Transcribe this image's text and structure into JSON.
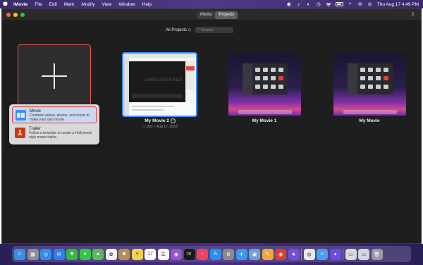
{
  "menubar": {
    "app_name": "iMovie",
    "items": [
      "File",
      "Edit",
      "Mark",
      "Modify",
      "View",
      "Window",
      "Help"
    ],
    "clock": "Thu Aug 17  4:49 PM"
  },
  "toolbar": {
    "tabs": [
      {
        "label": "Media",
        "active": false
      },
      {
        "label": "Projects",
        "active": true
      }
    ]
  },
  "filter": {
    "label": "All Projects ◇",
    "search_placeholder": "Search"
  },
  "projects": [
    {
      "name": "My Movie 2",
      "meta": "20s – Aug 17, 2023",
      "selected": true,
      "thumb_text": "UNREGISTERED"
    },
    {
      "name": "My Movie 1",
      "meta": "",
      "selected": false
    },
    {
      "name": "My Movie",
      "meta": "",
      "selected": false
    }
  ],
  "new_menu": {
    "items": [
      {
        "title": "Movie",
        "description": "Combine videos, photos, and music to make your own movie.",
        "highlighted": true
      },
      {
        "title": "Trailer",
        "description": "Follow a template to create a Hollywood style movie trailer.",
        "highlighted": false
      }
    ]
  },
  "dock": {
    "apps": [
      {
        "icon": "finder-icon",
        "glyph": "☺",
        "color": "#3a8ee6"
      },
      {
        "icon": "launchpad-icon",
        "glyph": "▦",
        "color": "#8d8d9a"
      },
      {
        "icon": "safari-icon",
        "glyph": "◎",
        "color": "#2f8df0"
      },
      {
        "icon": "mail-icon",
        "glyph": "✉",
        "color": "#2e7ff0"
      },
      {
        "icon": "facetime-icon",
        "glyph": "■",
        "color": "#35b64a"
      },
      {
        "icon": "messages-icon",
        "glyph": "●",
        "color": "#35c74a"
      },
      {
        "icon": "maps-icon",
        "glyph": "▲",
        "color": "#5db85a"
      },
      {
        "icon": "photos-icon",
        "glyph": "✿",
        "color": "#f2f2f2"
      },
      {
        "icon": "contacts-icon",
        "glyph": "☻",
        "color": "#b88d5a"
      },
      {
        "icon": "notes-icon",
        "glyph": "≡",
        "color": "#f2d24a"
      },
      {
        "icon": "calendar-icon",
        "glyph": "17",
        "color": "#ffffff"
      },
      {
        "icon": "reminders-icon",
        "glyph": "☰",
        "color": "#f5f5f5"
      },
      {
        "icon": "podcasts-icon",
        "glyph": "◉",
        "color": "#9b4fd4"
      },
      {
        "icon": "apple-tv-icon",
        "glyph": "tv",
        "color": "#1a1a1a"
      },
      {
        "icon": "music-icon",
        "glyph": "♪",
        "color": "#f2405a"
      },
      {
        "icon": "app-store-icon",
        "glyph": "A",
        "color": "#2e8df0"
      },
      {
        "icon": "system-preferences-icon",
        "glyph": "⚙",
        "color": "#8a8a8a"
      },
      {
        "icon": "testflight-icon",
        "glyph": "✈",
        "color": "#3a9af0"
      },
      {
        "icon": "preview-icon",
        "glyph": "▣",
        "color": "#6aa0d8"
      },
      {
        "icon": "pencil-icon",
        "glyph": "✎",
        "color": "#f2a83a"
      },
      {
        "icon": "screen-recorder-icon",
        "glyph": "◉",
        "color": "#e03c34"
      },
      {
        "icon": "imovie-icon",
        "glyph": "★",
        "color": "#7a4ad8"
      },
      {
        "icon": "chrome-icon",
        "glyph": "◍",
        "color": "#e8e8e8"
      },
      {
        "icon": "finder-active-icon",
        "glyph": "☺",
        "color": "#4a9ef2"
      },
      {
        "icon": "imovie-star-icon",
        "glyph": "✦",
        "color": "#6d4be0"
      },
      {
        "icon": "downloads-folder-icon",
        "glyph": "▭",
        "color": "#d9d9e0"
      },
      {
        "icon": "documents-folder-icon",
        "glyph": "▭",
        "color": "#cfd6e6"
      },
      {
        "icon": "trash-icon",
        "glyph": "🗑",
        "color": "#9a9aa6"
      }
    ]
  }
}
